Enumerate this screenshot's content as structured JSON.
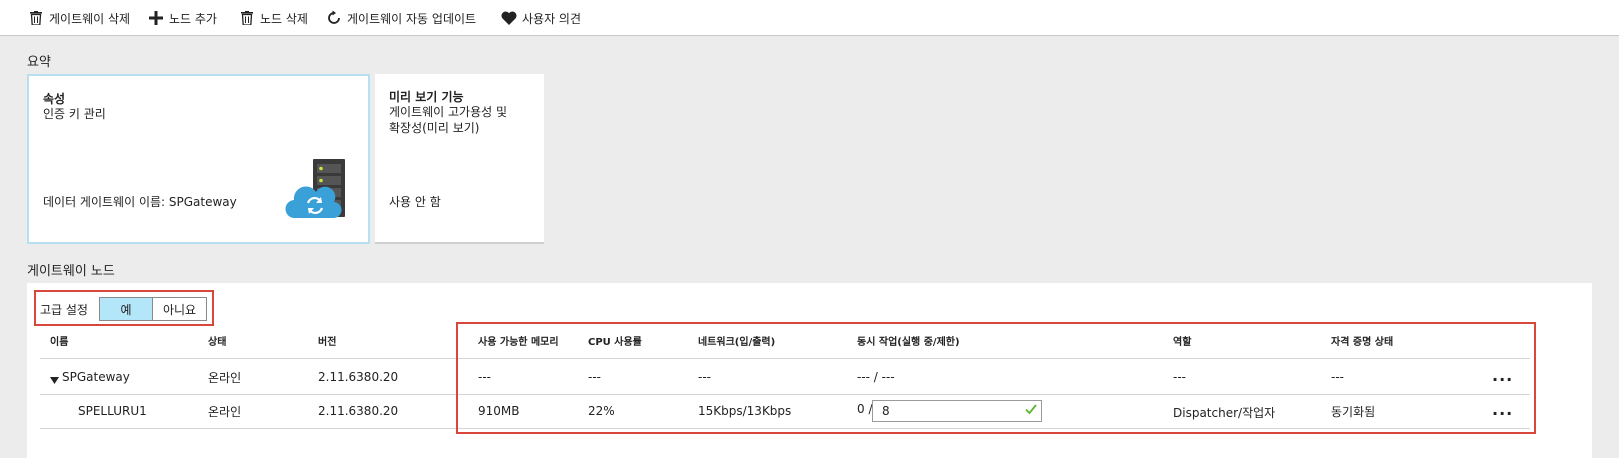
{
  "toolbar": {
    "delete_gateway": "게이트웨이 삭제",
    "add_node": "노드 추가",
    "delete_node": "노드 삭제",
    "auto_update": "게이트웨이 자동 업데이트",
    "feedback": "사용자 의견"
  },
  "summary": {
    "title": "요약",
    "properties_card": {
      "heading": "속성",
      "sub": "인증 키 관리",
      "footer": "데이터 게이트웨이 이름: SPGateway",
      "icon": "cloud-server-icon"
    },
    "preview_card": {
      "heading": "미리 보기 기능",
      "sub_line1": "게이트웨이 고가용성 및",
      "sub_line2": "확장성(미리 보기)",
      "footer": "사용 안 함"
    }
  },
  "nodes": {
    "title": "게이트웨이 노드",
    "advanced_label": "고급 설정",
    "toggle_yes": "예",
    "toggle_no": "아니요",
    "columns": {
      "name": "이름",
      "status": "상태",
      "version": "버전",
      "memory": "사용 가능한 메모리",
      "cpu": "CPU 사용률",
      "network": "네트워크(입/출력)",
      "concurrent": "동시 작업(실행 중/제한)",
      "role": "역할",
      "credential": "자격 증명 상태"
    },
    "rows": [
      {
        "name": "SPGateway",
        "status": "온라인",
        "version": "2.11.6380.20",
        "memory": "---",
        "cpu": "---",
        "network": "---",
        "concurrent": "--- / ---",
        "role": "---",
        "credential": "---",
        "more": "..."
      },
      {
        "name": "SPELLURU1",
        "status": "온라인",
        "version": "2.11.6380.20",
        "memory": "910MB",
        "cpu": "22%",
        "network": "15Kbps/13Kbps",
        "concurrent_running": "0 /",
        "concurrent_limit": "8",
        "role": "Dispatcher/작업자",
        "credential": "동기화됨",
        "more": "..."
      }
    ]
  },
  "colors": {
    "highlight": "#d9463b",
    "selected_border": "#b7dff0",
    "toggle_on": "#b4e6fa",
    "cloud": "#3aa0d8",
    "check": "#5cb82e"
  }
}
